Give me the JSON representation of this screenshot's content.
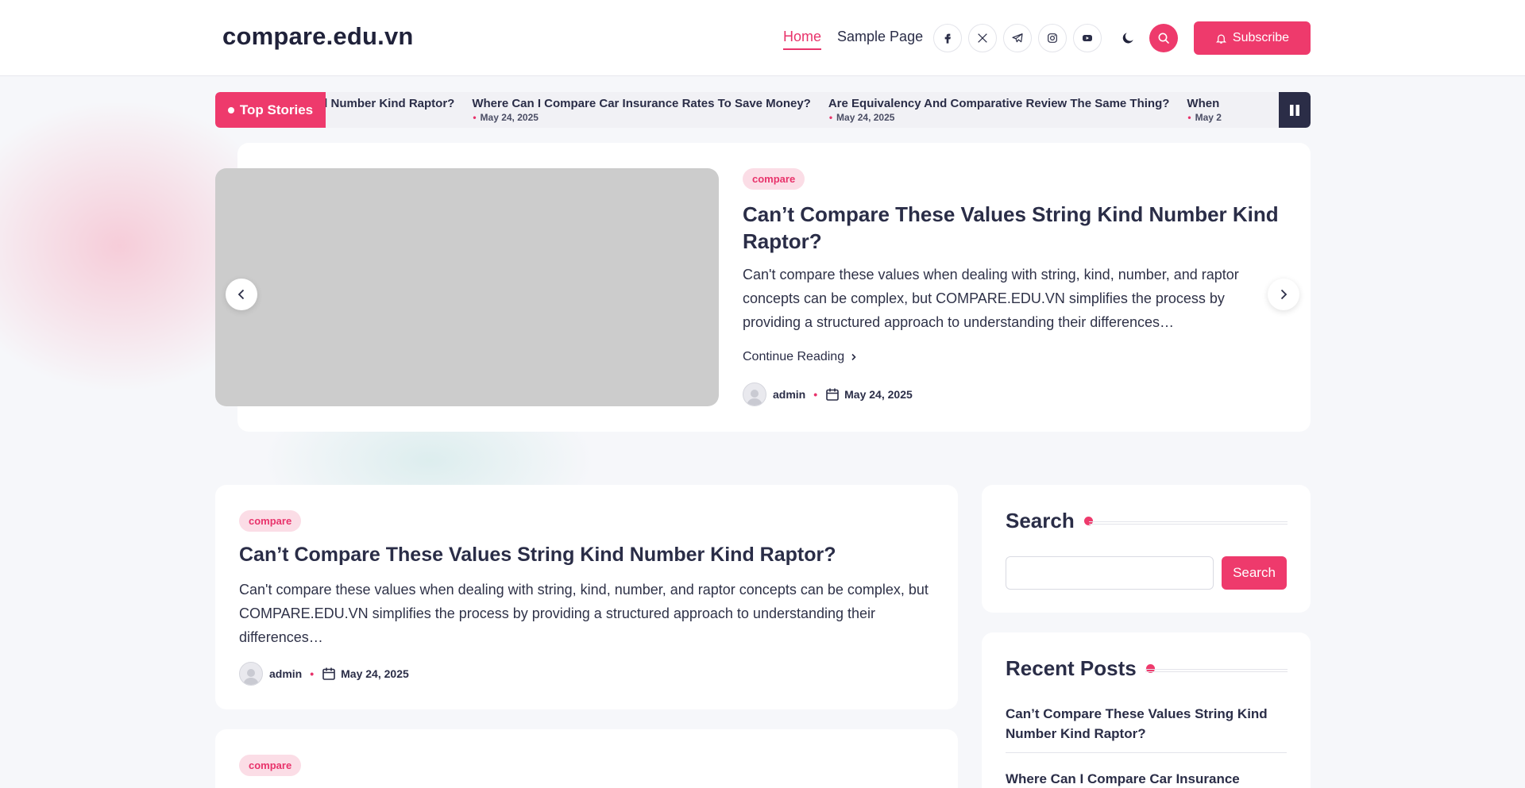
{
  "site": {
    "logo": "compare.edu.vn"
  },
  "nav": {
    "items": [
      {
        "label": "Home",
        "active": true
      },
      {
        "label": "Sample Page",
        "active": false
      }
    ]
  },
  "socials": [
    "facebook-icon",
    "x-icon",
    "telegram-icon",
    "instagram-icon",
    "youtube-icon"
  ],
  "header": {
    "subscribe_label": "Subscribe"
  },
  "ticker": {
    "label": "Top Stories",
    "items": [
      {
        "title": "Kind Number Kind Raptor?",
        "date": ""
      },
      {
        "title": "Where Can I Compare Car Insurance Rates To Save Money?",
        "date": "May 24, 2025"
      },
      {
        "title": "Are Equivalency And Comparative Review The Same Thing?",
        "date": "May 24, 2025"
      },
      {
        "title": "When",
        "date": "May 2"
      }
    ]
  },
  "slider": {
    "tag": "compare",
    "title": "Can’t Compare These Values String Kind Number Kind Raptor?",
    "excerpt": "Can't compare these values when dealing with string, kind, number, and raptor concepts can be complex, but COMPARE.EDU.VN simplifies the process by providing a structured approach to understanding their differences…",
    "continue_label": "Continue Reading",
    "author": "admin",
    "date": "May 24, 2025"
  },
  "post": {
    "tag": "compare",
    "title": "Can’t Compare These Values String Kind Number Kind Raptor?",
    "excerpt": "Can't compare these values when dealing with string, kind, number, and raptor concepts can be complex, but COMPARE.EDU.VN simplifies the process by providing a structured approach to understanding their differences…",
    "author": "admin",
    "date": "May 24, 2025"
  },
  "post2": {
    "tag": "compare"
  },
  "sidebar": {
    "search": {
      "title": "Search",
      "button_label": "Search",
      "input_value": ""
    },
    "recent": {
      "title": "Recent Posts",
      "items": [
        "Can’t Compare These Values String Kind Number Kind Raptor?",
        "Where Can I Compare Car Insurance"
      ]
    }
  },
  "colors": {
    "accent": "#ee3a6c",
    "dark": "#2b2d47",
    "background": "#f6f7fa"
  }
}
